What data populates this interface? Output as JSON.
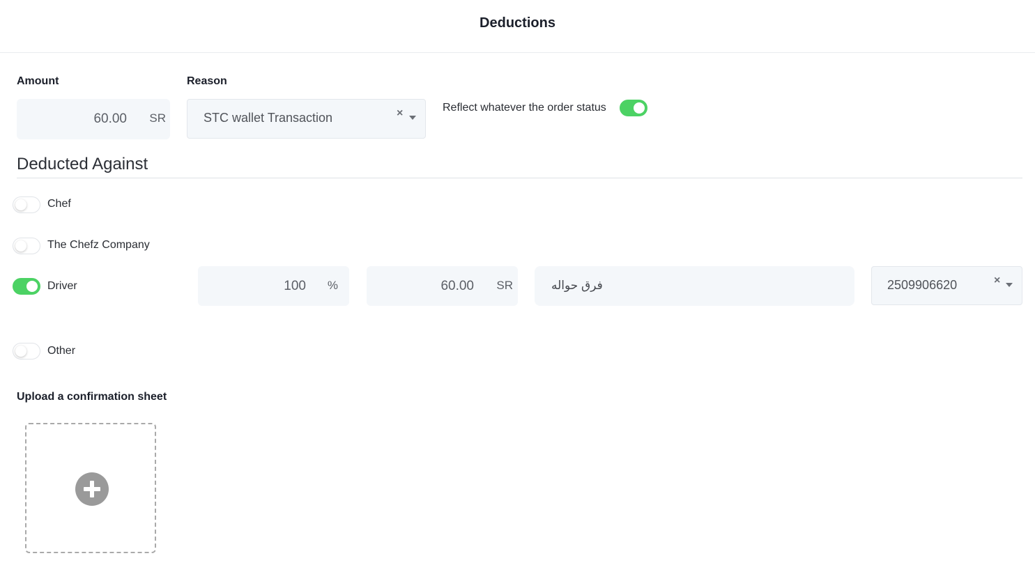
{
  "header": {
    "title": "Deductions"
  },
  "amount": {
    "label": "Amount",
    "value": "60.00",
    "unit": "SR"
  },
  "reason": {
    "label": "Reason",
    "selected": "STC wallet Transaction",
    "clear_icon": "×"
  },
  "reflect": {
    "label": "Reflect whatever the order status",
    "enabled": true
  },
  "deducted_against": {
    "title": "Deducted Against",
    "options": [
      {
        "label": "Chef",
        "enabled": false
      },
      {
        "label": "The Chefz Company",
        "enabled": false
      },
      {
        "label": "Driver",
        "enabled": true
      },
      {
        "label": "Other",
        "enabled": false
      }
    ],
    "driver": {
      "percent_value": "100",
      "percent_unit": "%",
      "amount_value": "60.00",
      "amount_unit": "SR",
      "note": "فرق حواله",
      "selected_id": "2509906620",
      "clear_icon": "×"
    }
  },
  "upload": {
    "label": "Upload a confirmation sheet",
    "icon": "plus-circle-icon"
  },
  "colors": {
    "toggle_on": "#4cd264",
    "field_bg": "#f4f7fa"
  }
}
